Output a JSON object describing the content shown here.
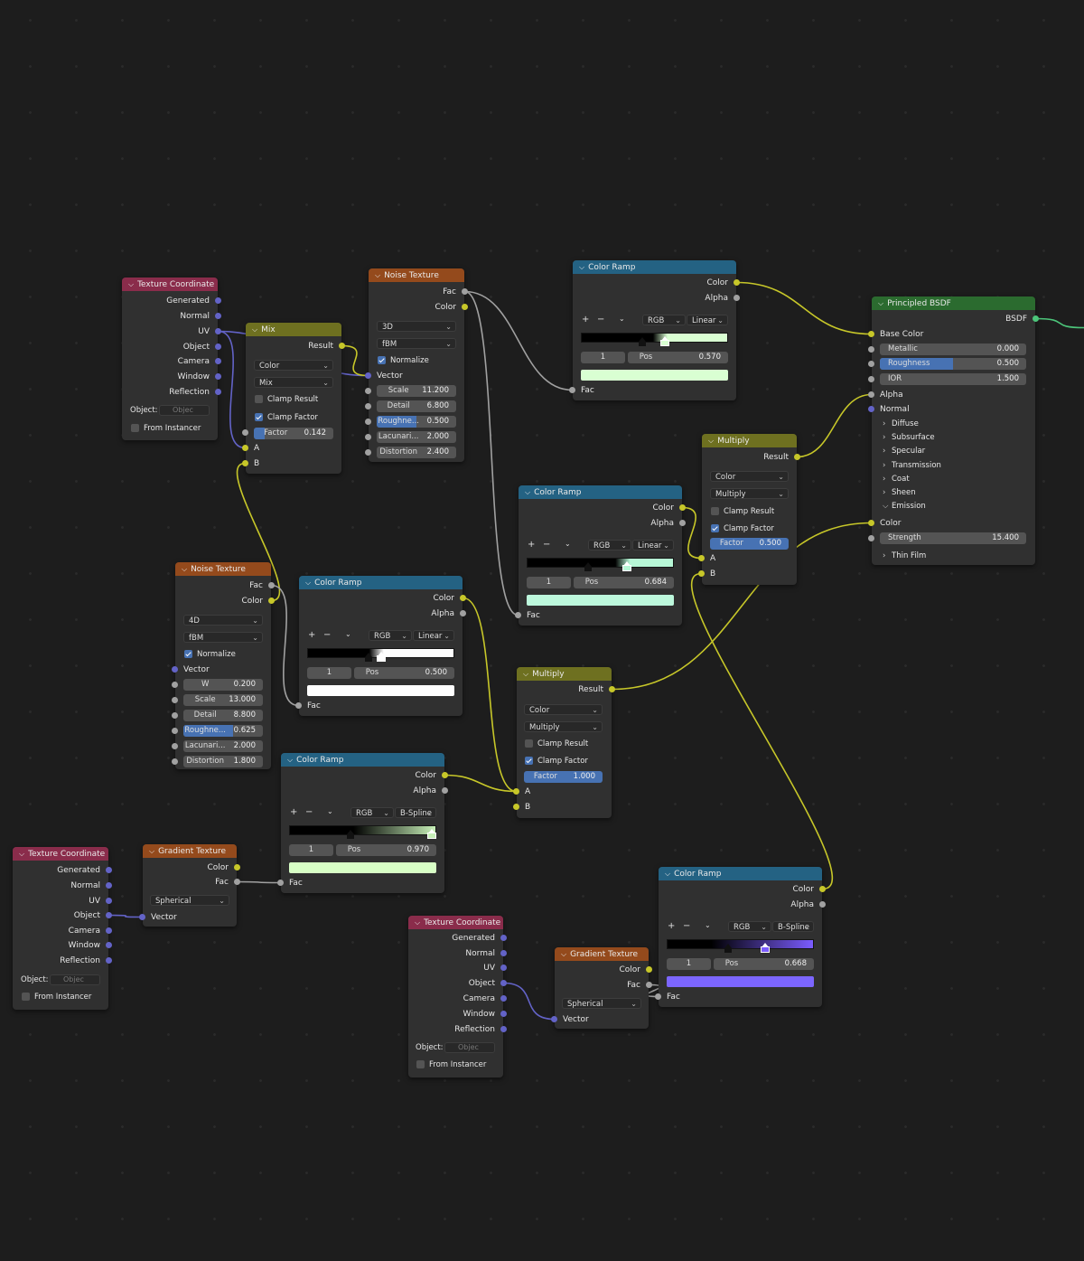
{
  "texcoord": {
    "title": "Texture Coordinate",
    "outputs": [
      "Generated",
      "Normal",
      "UV",
      "Object",
      "Camera",
      "Window",
      "Reflection"
    ],
    "object_label": "Object:",
    "object_placeholder": "Objec",
    "from_instancer": "From Instancer"
  },
  "mix": {
    "title": "Mix",
    "result": "Result",
    "data_type": "Color",
    "blend_mode": "Mix",
    "clamp_result": "Clamp Result",
    "clamp_factor": "Clamp Factor",
    "factor_label": "Factor",
    "factor_value": "0.142",
    "input_a": "A",
    "input_b": "B"
  },
  "noise1": {
    "title": "Noise Texture",
    "out_fac": "Fac",
    "out_color": "Color",
    "dimensions": "3D",
    "type": "fBM",
    "normalize": "Normalize",
    "vector": "Vector",
    "fields": [
      {
        "label": "Scale",
        "value": "11.200"
      },
      {
        "label": "Detail",
        "value": "6.800"
      },
      {
        "label": "Roughne...",
        "value": "0.500",
        "progress": 0.5
      },
      {
        "label": "Lacunari...",
        "value": "2.000"
      },
      {
        "label": "Distortion",
        "value": "2.400"
      }
    ]
  },
  "noise2": {
    "title": "Noise Texture",
    "out_fac": "Fac",
    "out_color": "Color",
    "dimensions": "4D",
    "type": "fBM",
    "normalize": "Normalize",
    "vector": "Vector",
    "fields": [
      {
        "label": "W",
        "value": "0.200"
      },
      {
        "label": "Scale",
        "value": "13.000"
      },
      {
        "label": "Detail",
        "value": "8.800"
      },
      {
        "label": "Roughne...",
        "value": "0.625",
        "progress": 0.625
      },
      {
        "label": "Lacunari...",
        "value": "2.000"
      },
      {
        "label": "Distortion",
        "value": "1.800"
      }
    ]
  },
  "ramps": [
    {
      "title": "Color Ramp",
      "out_color": "Color",
      "out_alpha": "Alpha",
      "mode": "RGB",
      "interp": "Linear",
      "index": "1",
      "pos_label": "Pos",
      "pos": "0.570",
      "input": "Fac",
      "c1": "#000000",
      "c2": "#d9ffd2",
      "swatch": "#d9ffd2"
    },
    {
      "title": "Color Ramp",
      "out_color": "Color",
      "out_alpha": "Alpha",
      "mode": "RGB",
      "interp": "Linear",
      "index": "1",
      "pos_label": "Pos",
      "pos": "0.684",
      "input": "Fac",
      "c1": "#000000",
      "c2": "#b7f7d6",
      "swatch": "#bdf8dc"
    },
    {
      "title": "Color Ramp",
      "out_color": "Color",
      "out_alpha": "Alpha",
      "mode": "RGB",
      "interp": "Linear",
      "index": "1",
      "pos_label": "Pos",
      "pos": "0.500",
      "input": "Fac",
      "c1": "#000000",
      "c2": "#ffffff",
      "swatch": "#ffffff"
    },
    {
      "title": "Color Ramp",
      "out_color": "Color",
      "out_alpha": "Alpha",
      "mode": "RGB",
      "interp": "B-Spline",
      "index": "1",
      "pos_label": "Pos",
      "pos": "0.970",
      "input": "Fac",
      "c1": "#000000",
      "c2": "#c7f0b8",
      "swatch": "#d8ffc6"
    },
    {
      "title": "Color Ramp",
      "out_color": "Color",
      "out_alpha": "Alpha",
      "mode": "RGB",
      "interp": "B-Spline",
      "index": "1",
      "pos_label": "Pos",
      "pos": "0.668",
      "input": "Fac",
      "c1": "#000000",
      "c2": "#7b5cff",
      "swatch": "#7c66ff"
    }
  ],
  "multiply1": {
    "title": "Multiply",
    "result": "Result",
    "data_type": "Color",
    "blend_mode": "Multiply",
    "clamp_result": "Clamp Result",
    "clamp_factor": "Clamp Factor",
    "factor_label": "Factor",
    "factor_value": "0.500",
    "input_a": "A",
    "input_b": "B"
  },
  "multiply2": {
    "title": "Multiply",
    "result": "Result",
    "data_type": "Color",
    "blend_mode": "Multiply",
    "clamp_result": "Clamp Result",
    "clamp_factor": "Clamp Factor",
    "factor_label": "Factor",
    "factor_value": "1.000",
    "input_a": "A",
    "input_b": "B"
  },
  "gradient": {
    "title": "Gradient Texture",
    "out_color": "Color",
    "out_fac": "Fac",
    "type": "Spherical",
    "vector": "Vector"
  },
  "bsdf": {
    "title": "Principled BSDF",
    "out": "BSDF",
    "base_color": "Base Color",
    "metallic_label": "Metallic",
    "metallic": "0.000",
    "roughness_label": "Roughness",
    "roughness": "0.500",
    "roughness_progress": 0.5,
    "ior_label": "IOR",
    "ior": "1.500",
    "alpha": "Alpha",
    "normal": "Normal",
    "panels": [
      "Diffuse",
      "Subsurface",
      "Specular",
      "Transmission",
      "Coat",
      "Sheen"
    ],
    "emission": "Emission",
    "emission_color": "Color",
    "strength_label": "Strength",
    "strength": "15.400",
    "thin_film": "Thin Film"
  },
  "colors": {
    "wire_color": "#c7c729",
    "wire_float": "#a1a1a1",
    "wire_vector": "#6363c7",
    "wire_shader": "#4cc57a"
  }
}
